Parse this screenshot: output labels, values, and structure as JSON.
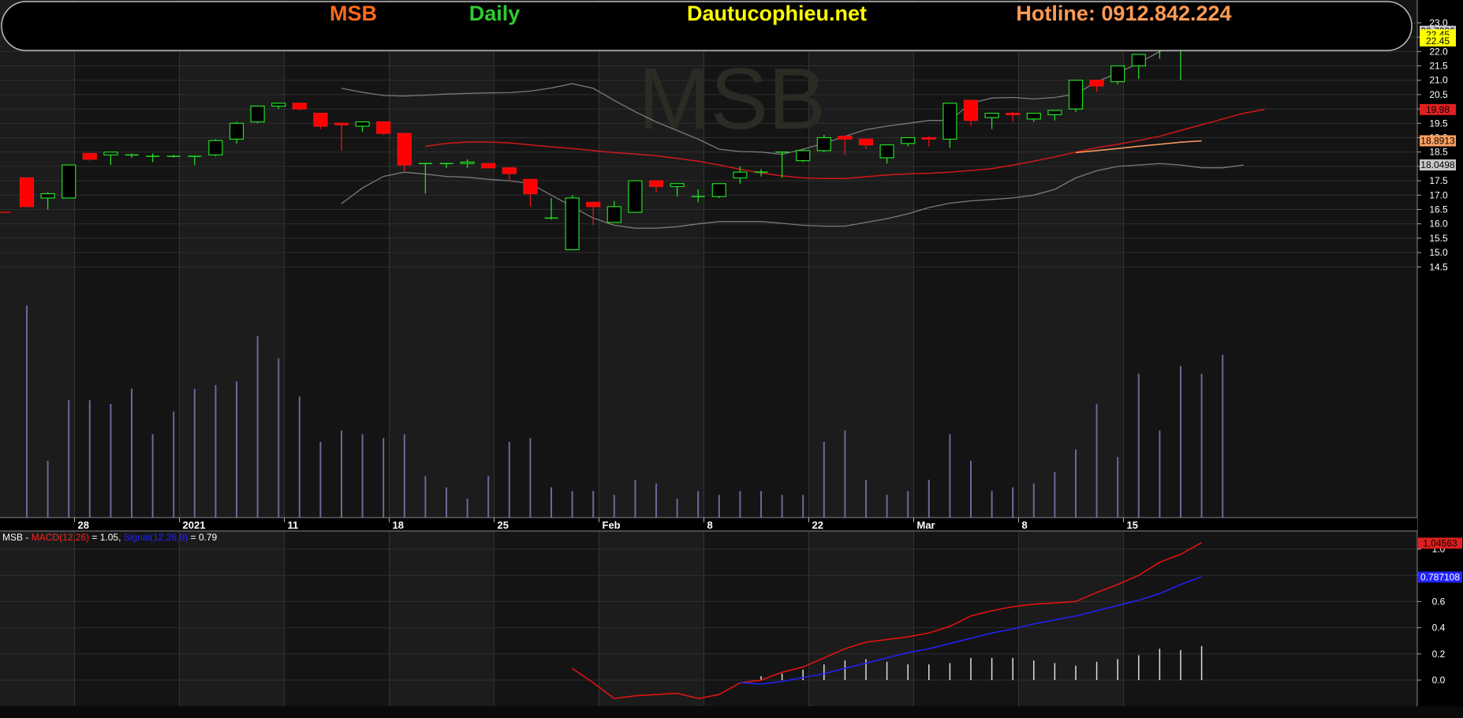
{
  "header": {
    "symbol": "MSB",
    "period": "Daily",
    "site": "Dautucophieu.net",
    "hotline": "Hotline: 0912.842.224",
    "colors": {
      "symbol": "#ff6a1a",
      "period": "#2ecc2e",
      "site": "#ffff00",
      "hotline": "#ff9a55"
    }
  },
  "watermark": "MSB",
  "macd_panel": {
    "name": "MSB",
    "sep": " - ",
    "macd_label": "MACD(12,26)",
    "macd_value": " = 1.05, ",
    "signal_label": "Signal(12,26,9)",
    "signal_value": " = 0.79",
    "macd_color": "#ff2020",
    "signal_color": "#2222ff"
  },
  "chart_data": [
    {
      "type": "candlestick",
      "title": "",
      "y_ticks": [
        "23.0",
        "22.5",
        "22.0",
        "21.5",
        "21.0",
        "20.5",
        "20.0",
        "19.5",
        "19.0",
        "18.5",
        "18.0",
        "17.5",
        "17.0",
        "16.5",
        "16.0",
        "15.5",
        "15.0",
        "14.5"
      ],
      "x_ticks": [
        {
          "label": "28",
          "i": 3
        },
        {
          "label": "2021",
          "i": 8
        },
        {
          "label": "11",
          "i": 13
        },
        {
          "label": "18",
          "i": 18
        },
        {
          "label": "25",
          "i": 23
        },
        {
          "label": "Feb",
          "i": 28
        },
        {
          "label": "8",
          "i": 33
        },
        {
          "label": "22",
          "i": 38
        },
        {
          "label": "Mar",
          "i": 43
        },
        {
          "label": "8",
          "i": 48
        },
        {
          "label": "15",
          "i": 53
        }
      ],
      "ylim": [
        14.3,
        23.1
      ],
      "candles": [
        [
          17.6,
          17.6,
          16.6,
          16.6
        ],
        [
          16.9,
          17.1,
          16.5,
          17.05
        ],
        [
          16.9,
          18.05,
          16.9,
          18.05
        ],
        [
          18.45,
          18.45,
          18.2,
          18.25
        ],
        [
          18.4,
          18.5,
          18.05,
          18.5
        ],
        [
          18.4,
          18.45,
          18.3,
          18.4
        ],
        [
          18.35,
          18.45,
          18.15,
          18.35
        ],
        [
          18.35,
          18.4,
          18.3,
          18.35
        ],
        [
          18.35,
          18.35,
          18.05,
          18.35
        ],
        [
          18.4,
          18.95,
          18.35,
          18.9
        ],
        [
          18.95,
          19.55,
          18.8,
          19.5
        ],
        [
          19.55,
          20.1,
          19.5,
          20.1
        ],
        [
          20.1,
          20.2,
          20.0,
          20.2
        ],
        [
          20.2,
          20.2,
          19.95,
          20.0
        ],
        [
          19.85,
          19.85,
          19.3,
          19.4
        ],
        [
          19.5,
          19.5,
          18.55,
          19.45
        ],
        [
          19.4,
          19.55,
          19.2,
          19.55
        ],
        [
          19.55,
          19.55,
          19.1,
          19.15
        ],
        [
          19.15,
          19.15,
          17.85,
          18.05
        ],
        [
          18.1,
          18.1,
          17.05,
          18.1
        ],
        [
          18.1,
          18.1,
          17.95,
          18.1
        ],
        [
          18.1,
          18.25,
          17.95,
          18.15
        ],
        [
          18.1,
          18.1,
          17.95,
          17.95
        ],
        [
          17.95,
          17.95,
          17.5,
          17.75
        ],
        [
          17.55,
          17.55,
          16.6,
          17.05
        ],
        [
          16.2,
          16.9,
          16.15,
          16.2
        ],
        [
          15.1,
          17.0,
          15.1,
          16.9
        ],
        [
          16.75,
          16.75,
          15.95,
          16.6
        ],
        [
          16.05,
          16.8,
          16.05,
          16.6
        ],
        [
          16.4,
          17.5,
          16.4,
          17.5
        ],
        [
          17.5,
          17.5,
          17.1,
          17.3
        ],
        [
          17.3,
          17.4,
          16.95,
          17.4
        ],
        [
          16.95,
          17.2,
          16.75,
          16.95
        ],
        [
          16.95,
          17.4,
          16.9,
          17.4
        ],
        [
          17.6,
          18.0,
          17.4,
          17.8
        ],
        [
          17.8,
          17.9,
          17.65,
          17.8
        ],
        [
          18.5,
          18.5,
          17.6,
          18.5
        ],
        [
          18.2,
          18.6,
          18.15,
          18.55
        ],
        [
          18.55,
          19.1,
          18.5,
          19.0
        ],
        [
          19.05,
          19.05,
          18.4,
          18.95
        ],
        [
          18.95,
          18.95,
          18.6,
          18.75
        ],
        [
          18.3,
          18.75,
          18.1,
          18.75
        ],
        [
          18.8,
          19.0,
          18.7,
          19.0
        ],
        [
          19.0,
          19.05,
          18.7,
          18.95
        ],
        [
          18.95,
          20.2,
          18.65,
          20.2
        ],
        [
          20.3,
          20.3,
          19.4,
          19.6
        ],
        [
          19.7,
          19.85,
          19.3,
          19.85
        ],
        [
          19.85,
          19.9,
          19.55,
          19.8
        ],
        [
          19.65,
          19.85,
          19.55,
          19.85
        ],
        [
          19.8,
          19.95,
          19.6,
          19.95
        ],
        [
          20.0,
          21.0,
          19.9,
          21.0
        ],
        [
          21.0,
          21.0,
          20.6,
          20.8
        ],
        [
          20.95,
          21.5,
          20.85,
          21.5
        ],
        [
          21.5,
          21.9,
          21.05,
          21.9
        ],
        [
          22.2,
          22.7,
          21.75,
          22.2
        ],
        [
          22.25,
          22.5,
          21.0,
          22.45
        ]
      ],
      "volume": [
        0.56,
        0.15,
        0.31,
        0.31,
        0.3,
        0.34,
        0.22,
        0.28,
        0.34,
        0.35,
        0.36,
        0.48,
        0.42,
        0.32,
        0.2,
        0.23,
        0.22,
        0.21,
        0.22,
        0.11,
        0.08,
        0.05,
        0.11,
        0.2,
        0.21,
        0.08,
        0.07,
        0.07,
        0.06,
        0.1,
        0.09,
        0.05,
        0.07,
        0.06,
        0.07,
        0.07,
        0.06,
        0.06,
        0.2,
        0.23,
        0.1,
        0.06,
        0.07,
        0.1,
        0.22,
        0.15,
        0.07,
        0.08,
        0.09,
        0.12,
        0.18,
        0.3,
        0.16,
        0.38,
        0.23,
        0.4,
        0.38,
        0.43
      ],
      "bollinger_upper": [
        null,
        null,
        null,
        null,
        null,
        null,
        null,
        null,
        null,
        null,
        null,
        null,
        null,
        null,
        null,
        20.72,
        20.58,
        20.47,
        20.45,
        20.48,
        20.52,
        20.54,
        20.56,
        20.57,
        20.62,
        20.73,
        20.88,
        20.72,
        20.3,
        19.9,
        19.55,
        19.25,
        18.95,
        18.6,
        18.52,
        18.5,
        18.42,
        18.6,
        18.8,
        19.05,
        19.28,
        19.4,
        19.5,
        19.6,
        19.6,
        20.2,
        20.38,
        20.4,
        20.35,
        20.4,
        20.52,
        20.95,
        21.25,
        21.6,
        22.0,
        22.35,
        22.7
      ],
      "bollinger_mid": [
        null,
        null,
        null,
        null,
        null,
        null,
        null,
        null,
        null,
        null,
        null,
        null,
        null,
        null,
        null,
        null,
        null,
        null,
        null,
        18.7,
        18.8,
        18.85,
        18.85,
        18.82,
        18.75,
        18.68,
        18.62,
        18.55,
        18.48,
        18.43,
        18.37,
        18.28,
        18.18,
        18.05,
        17.9,
        17.77,
        17.67,
        17.6,
        17.58,
        17.58,
        17.64,
        17.7,
        17.74,
        17.76,
        17.8,
        17.86,
        17.92,
        18.05,
        18.18,
        18.33,
        18.5,
        18.65,
        18.77,
        18.9,
        19.05,
        19.25,
        19.45,
        19.65,
        19.85,
        19.98
      ],
      "ma_extra": [
        null,
        null,
        null,
        null,
        null,
        null,
        null,
        null,
        null,
        null,
        null,
        null,
        null,
        null,
        null,
        null,
        null,
        null,
        null,
        null,
        null,
        null,
        null,
        null,
        null,
        null,
        null,
        null,
        null,
        null,
        null,
        null,
        null,
        null,
        null,
        null,
        null,
        null,
        null,
        null,
        null,
        null,
        null,
        null,
        null,
        null,
        null,
        null,
        null,
        null,
        18.48,
        18.55,
        18.62,
        18.7,
        18.77,
        18.84,
        18.89
      ],
      "bollinger_lower": [
        null,
        null,
        null,
        null,
        null,
        null,
        null,
        null,
        null,
        null,
        null,
        null,
        null,
        null,
        null,
        16.7,
        17.25,
        17.65,
        17.8,
        17.73,
        17.65,
        17.62,
        17.55,
        17.5,
        17.4,
        17.0,
        16.6,
        16.2,
        15.95,
        15.85,
        15.85,
        15.9,
        16.0,
        16.08,
        16.08,
        16.08,
        16.02,
        15.95,
        15.92,
        15.92,
        16.05,
        16.18,
        16.35,
        16.57,
        16.72,
        16.8,
        16.85,
        16.9,
        17.0,
        17.2,
        17.6,
        17.85,
        18.0,
        18.05,
        18.1,
        18.05,
        17.95,
        17.95,
        18.05
      ],
      "last_price": "22.45",
      "tags": [
        {
          "label": "22.7036",
          "value": 22.7036,
          "bg": "#c8c8c8",
          "fg": "#000000"
        },
        {
          "label": "22.45",
          "value": 22.58,
          "bg": "#ffff00",
          "fg": "#000000"
        },
        {
          "label": "22.45",
          "value": 22.37,
          "bg": "#ffff00",
          "fg": "#000000"
        },
        {
          "label": "19.98",
          "value": 19.98,
          "bg": "#e02020",
          "fg": "#000000"
        },
        {
          "label": "18.8913",
          "value": 18.8913,
          "bg": "#ffa060",
          "fg": "#000000"
        },
        {
          "label": "18.0498",
          "value": 18.0498,
          "bg": "#c8c8c8",
          "fg": "#000000"
        }
      ]
    },
    {
      "type": "line",
      "title": "MACD",
      "y_ticks": [
        "1.0",
        "0.8",
        "0.6",
        "0.4",
        "0.2",
        "0.0"
      ],
      "ylim": [
        -0.17,
        1.13
      ],
      "macd": [
        null,
        null,
        null,
        null,
        null,
        null,
        null,
        null,
        null,
        null,
        null,
        null,
        null,
        null,
        null,
        null,
        null,
        null,
        null,
        null,
        null,
        null,
        null,
        null,
        null,
        null,
        0.09,
        -0.02,
        -0.14,
        -0.12,
        -0.11,
        -0.1,
        -0.14,
        -0.11,
        -0.02,
        0.0,
        0.06,
        0.1,
        0.17,
        0.24,
        0.29,
        0.31,
        0.33,
        0.36,
        0.41,
        0.49,
        0.53,
        0.56,
        0.58,
        0.59,
        0.6,
        0.67,
        0.73,
        0.8,
        0.9,
        0.96,
        1.05
      ],
      "signal": [
        null,
        null,
        null,
        null,
        null,
        null,
        null,
        null,
        null,
        null,
        null,
        null,
        null,
        null,
        null,
        null,
        null,
        null,
        null,
        null,
        null,
        null,
        null,
        null,
        null,
        null,
        null,
        null,
        null,
        null,
        null,
        null,
        null,
        null,
        -0.02,
        -0.03,
        -0.01,
        0.02,
        0.05,
        0.09,
        0.13,
        0.17,
        0.21,
        0.24,
        0.28,
        0.32,
        0.36,
        0.39,
        0.43,
        0.46,
        0.49,
        0.53,
        0.57,
        0.61,
        0.66,
        0.73,
        0.79
      ],
      "histogram": [
        null,
        null,
        null,
        null,
        null,
        null,
        null,
        null,
        null,
        null,
        null,
        null,
        null,
        null,
        null,
        null,
        null,
        null,
        null,
        null,
        null,
        null,
        null,
        null,
        null,
        null,
        null,
        null,
        null,
        null,
        null,
        null,
        null,
        null,
        0.0,
        0.03,
        0.05,
        0.08,
        0.12,
        0.15,
        0.16,
        0.14,
        0.12,
        0.12,
        0.13,
        0.17,
        0.17,
        0.17,
        0.15,
        0.13,
        0.11,
        0.14,
        0.16,
        0.19,
        0.24,
        0.23,
        0.26
      ],
      "tags": [
        {
          "label": "1.04563",
          "value": 1.0456,
          "bg": "#e02020",
          "fg": "#000000"
        },
        {
          "label": "0.787108",
          "value": 0.7871,
          "bg": "#2222ff",
          "fg": "#ffffff"
        }
      ]
    }
  ]
}
